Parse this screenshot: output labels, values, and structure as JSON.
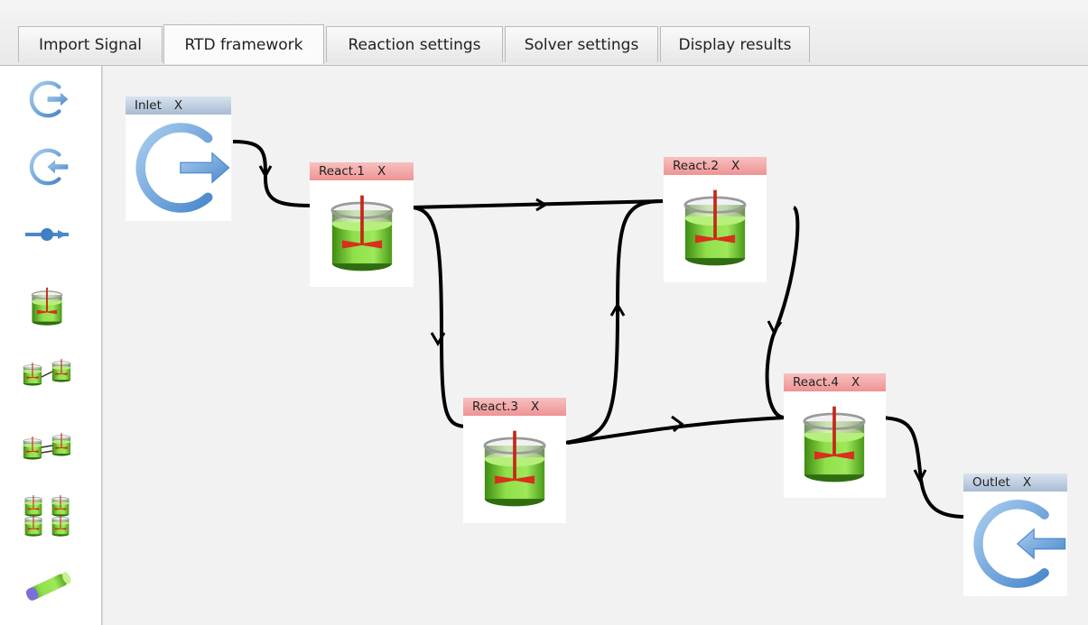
{
  "tabs": [
    {
      "label": "Import Signal"
    },
    {
      "label": "RTD framework"
    },
    {
      "label": "Reaction settings"
    },
    {
      "label": "Solver settings"
    },
    {
      "label": "Display results"
    }
  ],
  "active_tab": "RTD framework",
  "palette": [
    {
      "icon": "inlet-icon"
    },
    {
      "icon": "outlet-icon"
    },
    {
      "icon": "connector-icon"
    },
    {
      "icon": "reactor-icon"
    },
    {
      "icon": "reactors-series-icon"
    },
    {
      "icon": "reactors-parallel-icon"
    },
    {
      "icon": "reactors-stack-icon"
    },
    {
      "icon": "plug-flow-icon"
    }
  ],
  "nodes": {
    "inlet": {
      "label": "Inlet",
      "close": "X"
    },
    "react1": {
      "label": "React.1",
      "close": "X"
    },
    "react2": {
      "label": "React.2",
      "close": "X"
    },
    "react3": {
      "label": "React.3",
      "close": "X"
    },
    "react4": {
      "label": "React.4",
      "close": "X"
    },
    "outlet": {
      "label": "Outlet",
      "close": "X"
    }
  },
  "connections": [
    {
      "from": "Inlet",
      "to": "React.1"
    },
    {
      "from": "React.1",
      "to": "React.2"
    },
    {
      "from": "React.1",
      "to": "React.3"
    },
    {
      "from": "React.3",
      "to": "React.2"
    },
    {
      "from": "React.2",
      "to": "React.4"
    },
    {
      "from": "React.3",
      "to": "React.4"
    },
    {
      "from": "React.4",
      "to": "Outlet"
    }
  ],
  "colors": {
    "reactor_green": "#7fd43a",
    "stirrer_red": "#c42818",
    "inlet_blue": "#5b9ad8",
    "header_blue": "#b7c7dc",
    "header_red": "#f2a7a7"
  }
}
